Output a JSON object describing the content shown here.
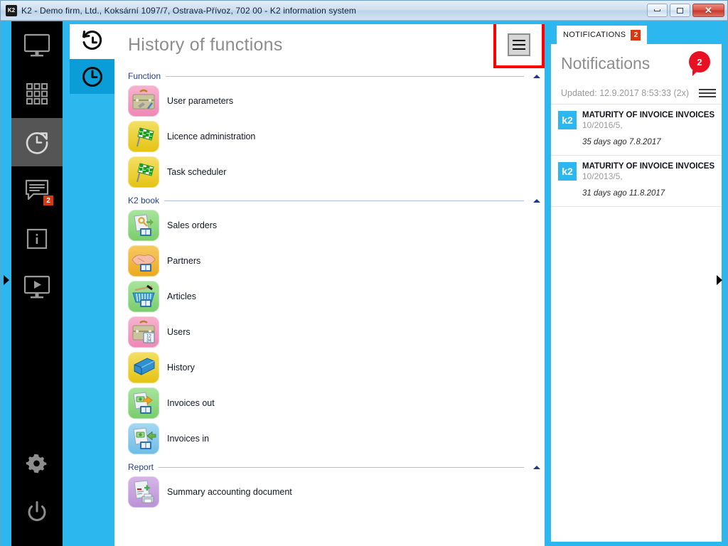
{
  "window": {
    "title": "K2 - Demo firm, Ltd., Koksární 1097/7, Ostrava-Přívoz, 702 00 - K2 information system",
    "app_icon": "k2-app-icon",
    "app_icon_text": "K2",
    "controls": {
      "minimize": "minimize-button",
      "maximize": "maximize-button",
      "close": "close-button",
      "close_glyph": "✕"
    }
  },
  "colors": {
    "accent_blue": "#2cb8ef",
    "tab_blue": "#0b9dd7",
    "badge_red": "#d8380f",
    "bubble_red": "#e81123",
    "highlight_red": "#fe0000",
    "rail_black": "#000000",
    "rail_active": "#555555",
    "section_label_blue": "#24418e",
    "title_gray": "#8d8d8d"
  },
  "rail": {
    "top_items": [
      {
        "name": "sidebar-item-desktop",
        "icon": "monitor-icon",
        "active": false,
        "badge": null
      },
      {
        "name": "sidebar-item-apps",
        "icon": "grid-apps-icon",
        "active": false,
        "badge": null
      },
      {
        "name": "sidebar-item-history",
        "icon": "history-clock-icon",
        "active": true,
        "badge": null
      },
      {
        "name": "sidebar-item-messages",
        "icon": "chat-bubble-icon",
        "active": false,
        "badge": "2"
      },
      {
        "name": "sidebar-item-info",
        "icon": "info-icon",
        "active": false,
        "badge": null
      },
      {
        "name": "sidebar-item-media",
        "icon": "video-screen-icon",
        "active": false,
        "badge": null
      }
    ],
    "bottom_items": [
      {
        "name": "sidebar-item-settings",
        "icon": "gear-icon",
        "active": false,
        "badge": null
      },
      {
        "name": "sidebar-item-power",
        "icon": "power-icon",
        "active": false,
        "badge": null
      }
    ],
    "left_expander": "expand-left-panel-arrow"
  },
  "tabs": [
    {
      "name": "tab-history-of-functions",
      "icon": "history-rewind-clock-icon",
      "state": "white"
    },
    {
      "name": "tab-recent-clock",
      "icon": "clock-icon",
      "state": "blue"
    }
  ],
  "main": {
    "title": "History of functions",
    "menu_button": "hamburger-menu-button",
    "sections": [
      {
        "label": "Function",
        "collapse_icon": "chevron-up-icon",
        "items": [
          {
            "label": "User parameters",
            "icon": "briefcase-tools-icon",
            "bg": "#f49ac1",
            "accent": "#c8c59a"
          },
          {
            "label": "Licence administration",
            "icon": "checkered-flag-icon",
            "bg": "#ecd11e",
            "accent": "#18a01e"
          },
          {
            "label": "Task scheduler",
            "icon": "checkered-flag-icon",
            "bg": "#ecd11e",
            "accent": "#18a01e"
          }
        ]
      },
      {
        "label": "K2 book",
        "collapse_icon": "chevron-up-icon",
        "items": [
          {
            "label": "Sales orders",
            "icon": "document-key-book-icon",
            "bg": "#8fda86",
            "accent": "#d9b64a"
          },
          {
            "label": "Partners",
            "icon": "handshake-book-icon",
            "bg": "#f2b73d",
            "accent": "#f0a08a"
          },
          {
            "label": "Articles",
            "icon": "shopping-basket-book-icon",
            "bg": "#8fda86",
            "accent": "#3a9ed4"
          },
          {
            "label": "Users",
            "icon": "briefcase-numbers-icon",
            "bg": "#f49ac1",
            "accent": "#c8c59a"
          },
          {
            "label": "History",
            "icon": "blue-book-icon",
            "bg": "#ecd11e",
            "accent": "#2f7fc4"
          },
          {
            "label": "Invoices out",
            "icon": "invoice-out-book-icon",
            "bg": "#8fda86",
            "accent": "#f0a020"
          },
          {
            "label": "Invoices in",
            "icon": "invoice-in-book-icon",
            "bg": "#7fc7ea",
            "accent": "#6ab44a"
          }
        ]
      },
      {
        "label": "Report",
        "collapse_icon": "chevron-up-icon",
        "items": [
          {
            "label": "Summary accounting document",
            "icon": "document-printer-icon",
            "bg": "#c5a0dd",
            "accent": "#8f8f8f"
          }
        ]
      }
    ]
  },
  "notifications": {
    "tab_label": "NOTIFICATIONS",
    "tab_badge": "2",
    "panel_title": "Notifications",
    "count_badge": "2",
    "updated": "Updated: 12.9.2017 8:53:33 (2x)",
    "menu_icon": "notifications-menu-icon",
    "items": [
      {
        "avatar": "k2",
        "subject": "MATURITY OF INVOICE INVOICES O...",
        "reference": "10/2016/5,",
        "age": "35 days ago 7.8.2017"
      },
      {
        "avatar": "k2",
        "subject": "MATURITY OF INVOICE INVOICES O...",
        "reference": "10/2013/5,",
        "age": "31 days ago 11.8.2017"
      }
    ],
    "right_expander": "collapse-right-panel-arrow"
  }
}
